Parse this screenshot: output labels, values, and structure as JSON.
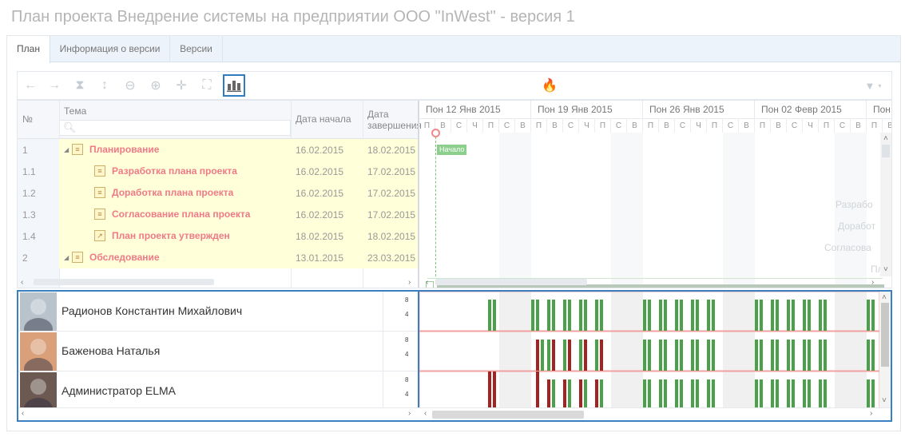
{
  "page_title": "План проекта Внедрение системы на предприятии ООО \"InWest\" - версия 1",
  "tabs": [
    {
      "label": "План"
    },
    {
      "label": "Информация о версии"
    },
    {
      "label": "Версии"
    }
  ],
  "toolbar": {
    "buttons": [
      "arrow-left-icon",
      "arrow-right-icon",
      "hourglass-icon",
      "expand-vertical-icon",
      "zoom-out-icon",
      "zoom-in-icon",
      "move-icon",
      "fit-icon",
      "resource-chart-icon"
    ],
    "center_icon": "fire-icon",
    "filter_icon": "filter-icon"
  },
  "grid": {
    "col_num": "№",
    "col_topic": "Тема",
    "col_start": "Дата начала",
    "col_end": "Дата завершения"
  },
  "tasks": [
    {
      "num": "1",
      "name": "Планирование",
      "start": "16.02.2015",
      "end": "18.02.2015",
      "level": 0,
      "icon": "folder-icon"
    },
    {
      "num": "1.1",
      "name": "Разработка плана проекта",
      "start": "16.02.2015",
      "end": "17.02.2015",
      "level": 1,
      "icon": "task-icon"
    },
    {
      "num": "1.2",
      "name": "Доработка плана проекта",
      "start": "16.02.2015",
      "end": "17.02.2015",
      "level": 1,
      "icon": "task-icon"
    },
    {
      "num": "1.3",
      "name": "Согласование плана проекта",
      "start": "16.02.2015",
      "end": "17.02.2015",
      "level": 1,
      "icon": "task-icon"
    },
    {
      "num": "1.4",
      "name": "План проекта утвержден",
      "start": "18.02.2015",
      "end": "18.02.2015",
      "level": 1,
      "icon": "milestone-icon"
    },
    {
      "num": "2",
      "name": "Обследование",
      "start": "13.01.2015",
      "end": "23.03.2015",
      "level": 0,
      "icon": "folder-icon"
    }
  ],
  "timeline": {
    "weeks": [
      "Пон 12 Янв 2015",
      "Пон 19 Янв 2015",
      "Пон 26 Янв 2015",
      "Пон 02 Февр 2015",
      "Пон"
    ],
    "days": [
      "П",
      "В",
      "С",
      "Ч",
      "П",
      "С",
      "В"
    ],
    "start_marker": "Начало",
    "ghost_labels": [
      "Разрабо",
      "Доработ",
      "Согласова",
      "Пл"
    ]
  },
  "resources": [
    {
      "name": "Радионов Константин Михайлович",
      "axis": [
        "8",
        "4"
      ]
    },
    {
      "name": "Баженова Наталья",
      "axis": [
        "8",
        "4"
      ]
    },
    {
      "name": "Администратор ELMA",
      "axis": [
        "8",
        "4"
      ]
    }
  ],
  "colors": {
    "accent": "#3a7fc1",
    "task_text": "#f07a88",
    "row_bg": "#ffffd9",
    "green": "#4aa14a",
    "red": "#a32222"
  }
}
